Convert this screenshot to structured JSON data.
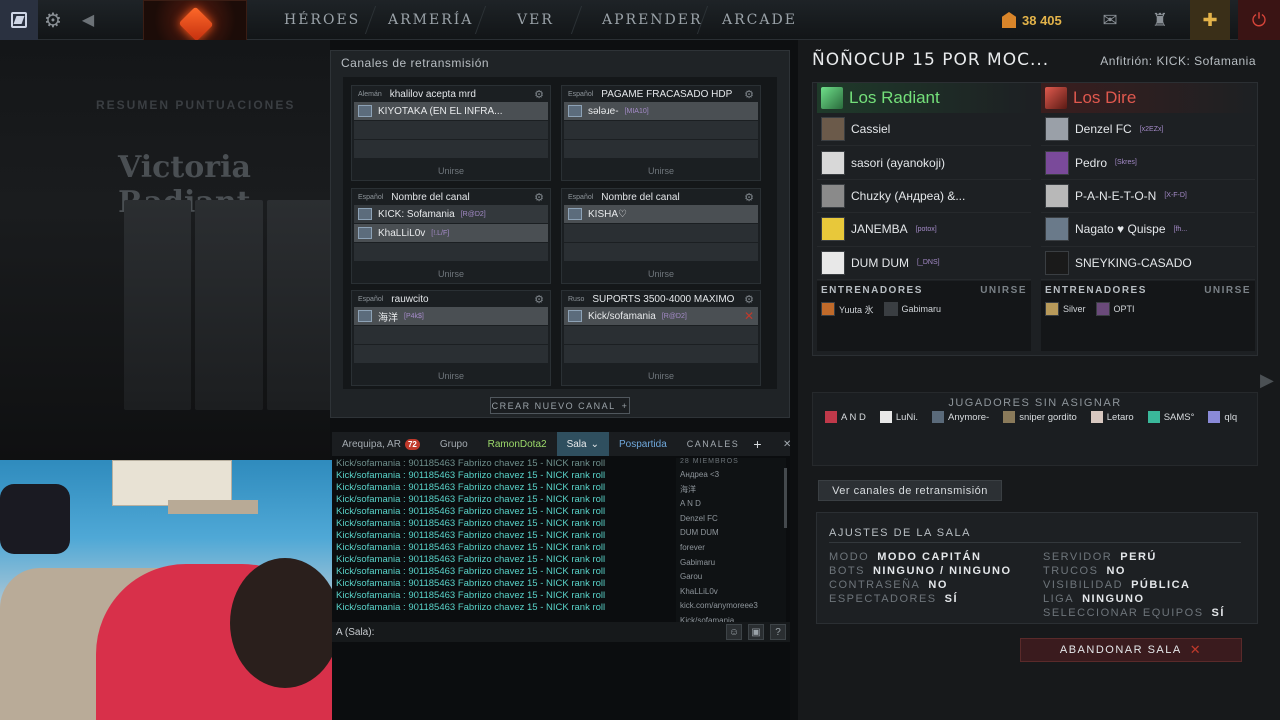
{
  "topbar": {
    "nav": [
      "HÉROES",
      "ARMERÍA",
      "VER",
      "APRENDER",
      "ARCADE"
    ],
    "gold_value": "38 405"
  },
  "leftbg": {
    "tabs": "RESUMEN     PUNTUACIONES",
    "victory": "Victoria Radiant"
  },
  "channels": {
    "title": "Canales de retransmisión",
    "join_label": "Unirse",
    "create_label": "CREAR NUEVO CANAL",
    "items": [
      {
        "lang": "Alemán",
        "name": "khalilov acepta mrd",
        "players": [
          {
            "name": "KIYOTAKA (EN EL INFRA...",
            "tag": ""
          }
        ]
      },
      {
        "lang": "Español",
        "name": "PAGAME FRACASADO HDP",
        "players": [
          {
            "name": "ѕәləɹe-",
            "tag": "[MIA10]"
          }
        ]
      },
      {
        "lang": "Español",
        "name": "Nombre del canal",
        "players": [
          {
            "name": "KICK: Sofamania",
            "tag": "[R@D2]"
          },
          {
            "name": "KhaLLiL0v",
            "tag": "[!.L/F]"
          }
        ]
      },
      {
        "lang": "Español",
        "name": "Nombre del canal",
        "players": [
          {
            "name": "KISHA♡",
            "tag": ""
          }
        ]
      },
      {
        "lang": "Español",
        "name": "rauwcito",
        "players": [
          {
            "name": "海洋",
            "tag": "[P4k$]"
          }
        ]
      },
      {
        "lang": "Ruso",
        "name": "SUPORTS 3500-4000 MAXIMO",
        "players": [
          {
            "name": "Kick/sofamania",
            "tag": "[R@D2]"
          }
        ]
      }
    ]
  },
  "chat": {
    "tabs": {
      "t1": "Arequipa, AR",
      "t1_badge": "72",
      "t2": "Grupo",
      "t3": "RamonDota2",
      "t4": "Sala",
      "t5": "Pospartida",
      "t6": "CANALES"
    },
    "messages": [
      "Kick/sofamania : 901185463 Fabriizo chavez 15 - NICK rank roll",
      "Kick/sofamania : 901185463 Fabriizo chavez 15 - NICK rank roll",
      "Kick/sofamania : 901185463 Fabriizo chavez 15 - NICK rank roll",
      "Kick/sofamania : 901185463 Fabriizo chavez 15 - NICK rank roll",
      "Kick/sofamania : 901185463 Fabriizo chavez 15 - NICK rank roll",
      "Kick/sofamania : 901185463 Fabriizo chavez 15 - NICK rank roll",
      "Kick/sofamania : 901185463 Fabriizo chavez 15 - NICK rank roll",
      "Kick/sofamania : 901185463 Fabriizo chavez 15 - NICK rank roll",
      "Kick/sofamania : 901185463 Fabriizo chavez 15 - NICK rank roll",
      "Kick/sofamania : 901185463 Fabriizo chavez 15 - NICK rank roll",
      "Kick/sofamania : 901185463 Fabriizo chavez 15 - NICK rank roll",
      "Kick/sofamania : 901185463 Fabriizo chavez 15 - NICK rank roll",
      "Kick/sofamania : 901185463 Fabriizo chavez 15 - NICK rank roll"
    ],
    "members_count": "28 MIEMBROS",
    "members": [
      "Андреа <3",
      "海洋",
      "A N D",
      "Denzel FC",
      "DUM DUM",
      "forever",
      "Gabimaru",
      "Garou",
      "KhaLLiL0v",
      "kick.com/anymoreee3",
      "Kick/sofamania"
    ],
    "input_prefix": "A (Sala):"
  },
  "lobby": {
    "title": "ÑOÑOCUP 15 POR MOC...",
    "host": "Anfitrión: KICK: Sofamania",
    "radiant": {
      "name": "Los Radiant",
      "players": [
        {
          "name": "Cassiel",
          "tag": ""
        },
        {
          "name": "sasori (ayanokoji)",
          "tag": ""
        },
        {
          "name": "Chuzky (Андреа) &...",
          "tag": ""
        },
        {
          "name": "JANEMBA",
          "tag": "[potox]"
        },
        {
          "name": "DUM DUM",
          "tag": "[_DNS]"
        }
      ],
      "coaches_label": "ENTRENADORES",
      "join_label": "UNIRSE",
      "coaches": [
        "Yuuta 氷",
        "Gabimaru"
      ]
    },
    "dire": {
      "name": "Los Dire",
      "players": [
        {
          "name": "Denzel FC",
          "tag": "[x2EZx]"
        },
        {
          "name": "Pedro",
          "tag": "[Skres]"
        },
        {
          "name": "P-A-N-E-T-O-N",
          "tag": "[X-F-D]"
        },
        {
          "name": "Nagato ♥ Quispe",
          "tag": "[fh..."
        },
        {
          "name": "SNEYKING-CASADO",
          "tag": ""
        }
      ],
      "coaches_label": "ENTRENADORES",
      "join_label": "UNIRSE",
      "coaches": [
        "Silver",
        "OPTI"
      ]
    },
    "unassigned_title": "JUGADORES SIN ASIGNAR",
    "unassigned": [
      "A N D",
      "LuNi.",
      "Anymore-",
      "sniper gordito",
      "Letaro",
      "SAMS°",
      "qlq"
    ],
    "view_channels_label": "Ver canales de retransmisión",
    "settings": {
      "title": "AJUSTES DE LA SALA",
      "left": [
        {
          "k": "MODO",
          "v": "MODO CAPITÁN"
        },
        {
          "k": "BOTS",
          "v": "NINGUNO / NINGUNO"
        },
        {
          "k": "CONTRASEÑA",
          "v": "NO"
        },
        {
          "k": "ESPECTADORES",
          "v": "SÍ"
        }
      ],
      "right": [
        {
          "k": "SERVIDOR",
          "v": "PERÚ"
        },
        {
          "k": "TRUCOS",
          "v": "NO"
        },
        {
          "k": "VISIBILIDAD",
          "v": "PÚBLICA"
        },
        {
          "k": "LIGA",
          "v": "NINGUNO"
        },
        {
          "k": "SELECCIONAR EQUIPOS",
          "v": "SÍ"
        }
      ]
    },
    "leave_label": "ABANDONAR SALA"
  }
}
